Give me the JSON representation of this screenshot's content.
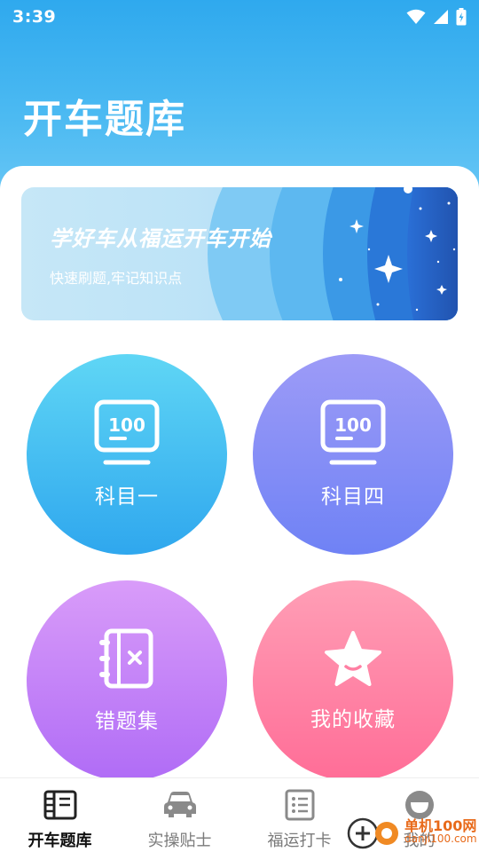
{
  "status_bar": {
    "time": "3:39"
  },
  "header": {
    "title": "开车题库"
  },
  "banner": {
    "title": "学好车从福运开车开始",
    "subtitle": "快速刷题,牢记知识点"
  },
  "cards": [
    {
      "label": "科目一",
      "icon": "score-100-icon"
    },
    {
      "label": "科目四",
      "icon": "score-100-icon"
    },
    {
      "label": "错题集",
      "icon": "wrong-notebook-icon"
    },
    {
      "label": "我的收藏",
      "icon": "star-icon"
    }
  ],
  "tabbar": {
    "active_index": 0,
    "tabs": [
      {
        "label": "开车题库",
        "icon": "book-icon"
      },
      {
        "label": "实操贴士",
        "icon": "car-icon"
      },
      {
        "label": "福运打卡",
        "icon": "checklist-icon"
      },
      {
        "label": "我的",
        "icon": "profile-icon"
      }
    ]
  },
  "watermark": {
    "line1": "单机100网",
    "line2": "danji100.com"
  },
  "colors": {
    "header_blue": "#2fa9ee",
    "card1": "#2fa7ee",
    "card2": "#6f82f5",
    "card3": "#b06cf6",
    "card4": "#ff6d97"
  }
}
